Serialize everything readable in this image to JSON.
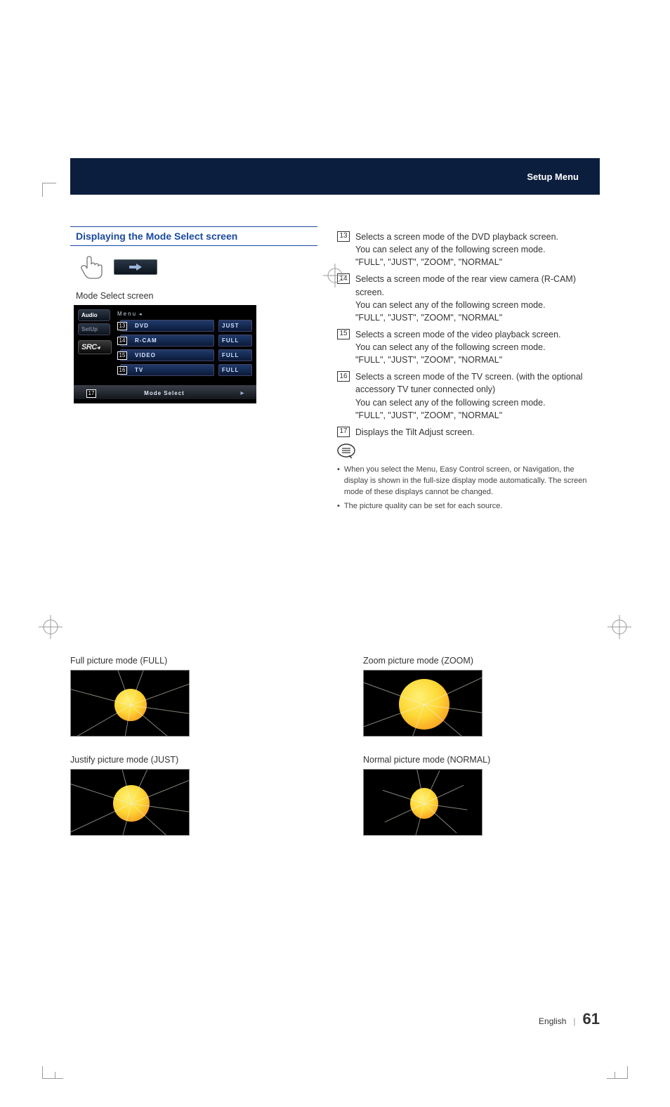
{
  "header": {
    "title": "Setup Menu"
  },
  "section": {
    "title": "Displaying the Mode Select screen",
    "caption": "Mode Select screen"
  },
  "modeScreen": {
    "tabs": {
      "audio": "Audio",
      "setup": "SetUp",
      "src": "SRC"
    },
    "menuHeader": "Menu",
    "rows": [
      {
        "num": "13",
        "label": "DVD",
        "value": "JUST"
      },
      {
        "num": "14",
        "label": "R-CAM",
        "value": "FULL"
      },
      {
        "num": "15",
        "label": "VIDEO",
        "value": "FULL"
      },
      {
        "num": "16",
        "label": "TV",
        "value": "FULL"
      }
    ],
    "footer": {
      "num": "17",
      "title": "Mode Select"
    }
  },
  "descriptions": [
    {
      "num": "13",
      "line1": "Selects a screen mode of the DVD playback screen.",
      "line2": "You can select any of the following screen mode.",
      "line3": "\"FULL\", \"JUST\", \"ZOOM\", \"NORMAL\""
    },
    {
      "num": "14",
      "line1": "Selects a screen mode of the rear view camera (R-CAM) screen.",
      "line2": "You can select any of the following screen mode.",
      "line3": "\"FULL\", \"JUST\", \"ZOOM\", \"NORMAL\""
    },
    {
      "num": "15",
      "line1": "Selects a screen mode of the video playback screen.",
      "line2": "You can select any of the following screen mode.",
      "line3": "\"FULL\", \"JUST\", \"ZOOM\", \"NORMAL\""
    },
    {
      "num": "16",
      "line1": "Selects a screen mode of the TV screen. (with the optional accessory TV tuner connected only)",
      "line2": "You can select any of the following screen mode.",
      "line3": "\"FULL\", \"JUST\", \"ZOOM\", \"NORMAL\""
    },
    {
      "num": "17",
      "line1": "Displays the Tilt Adjust screen."
    }
  ],
  "notes": [
    "When you select the Menu, Easy Control screen, or Navigation,  the display is shown in the full-size display mode automatically. The screen mode of these displays cannot be changed.",
    "The picture quality can be set for each source."
  ],
  "pictureModes": {
    "full": "Full picture mode (FULL)",
    "zoom": "Zoom picture mode (ZOOM)",
    "just": "Justify picture mode (JUST)",
    "normal": "Normal picture mode (NORMAL)"
  },
  "footer": {
    "language": "English",
    "page": "61"
  }
}
